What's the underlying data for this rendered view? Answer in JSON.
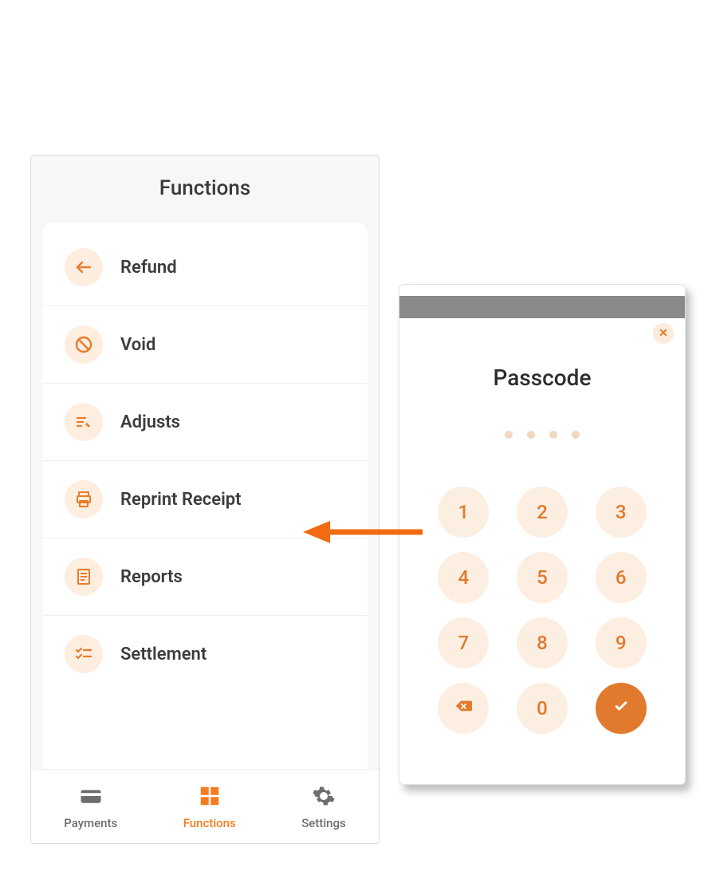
{
  "colors": {
    "accent": "#f47c20",
    "icon_bg": "#feeee0",
    "text": "#3c3c3c"
  },
  "functions": {
    "title": "Functions",
    "items": [
      {
        "label": "Refund",
        "icon": "return-arrow-icon"
      },
      {
        "label": "Void",
        "icon": "prohibit-icon"
      },
      {
        "label": "Adjusts",
        "icon": "edit-list-icon"
      },
      {
        "label": "Reprint Receipt",
        "icon": "printer-icon"
      },
      {
        "label": "Reports",
        "icon": "report-icon"
      },
      {
        "label": "Settlement",
        "icon": "checklist-icon"
      }
    ]
  },
  "nav": {
    "items": [
      {
        "label": "Payments",
        "icon": "card-icon",
        "active": false
      },
      {
        "label": "Functions",
        "icon": "grid-icon",
        "active": true
      },
      {
        "label": "Settings",
        "icon": "gear-icon",
        "active": false
      }
    ]
  },
  "passcode": {
    "title": "Passcode",
    "keys": [
      "1",
      "2",
      "3",
      "4",
      "5",
      "6",
      "7",
      "8",
      "9",
      "backspace",
      "0",
      "confirm"
    ],
    "digits": 4
  }
}
